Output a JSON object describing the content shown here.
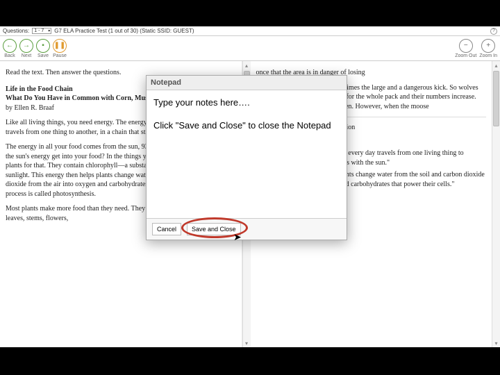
{
  "statusbar": {
    "questions_label": "Questions:",
    "questions_range": "1 - 7",
    "test_title": "G7 ELA Practice Test (1 out of 30)   (Static SSID: GUEST)"
  },
  "toolbar": {
    "back": "Back",
    "next": "Next",
    "save": "Save",
    "pause": "Pause",
    "zoom_out": "Zoom Out",
    "zoom_in": "Zoom In"
  },
  "left_pane": {
    "instruction": "Read the text. Then answer the questions.",
    "title": "Life in the Food Chain",
    "subtitle": "What Do You Have in Common with Corn, Mushrooms, Cows, and Grass?",
    "byline": "by Ellen R. Braaf",
    "p1": "Like all living things, you need energy. The energy you use to live every day travels from one thing to another, in a chain that starts with the sun.",
    "p2": "The energy in all your food comes from the sun, 93 million miles away. How did the sun's energy get into your food? In the things you eat? You can thank green plants for that. They contain chlorophyll—a substance that captures energy in sunlight. This energy then helps plants change water from the soil and carbon dioxide from the air into oxygen and carbohydrates that power their cells. This process is called photosynthesis.",
    "p3": "Most plants make more food than they need. They store the extra in their roots, leaves, stems, flowers,"
  },
  "right_pane": {
    "p1_frag": "once that the area is in danger of losing",
    "p2": "between predator and prey. Ten times the large and a dangerous kick. So wolves prey on old hunting means food for the whole pack and their numbers increase. More wolves mean more get eaten. However, when the moose",
    "question_stem1": "passage best support the conclusion",
    "question_stem2": "od chain?",
    "choice_a": "\"The energy you use to live every day travels from one living thing to another, in a chain that starts with the sun.\"",
    "choice_b": "\"This energy then helps plants change water from the soil and carbon dioxide from the air into oxygen and carbohydrates that power their cells.\""
  },
  "notepad": {
    "header": "Notepad",
    "line1": "Type your notes here….",
    "line2": "Click \"Save and Close\" to close the Notepad",
    "cancel": "Cancel",
    "save_close": "Save and Close"
  }
}
